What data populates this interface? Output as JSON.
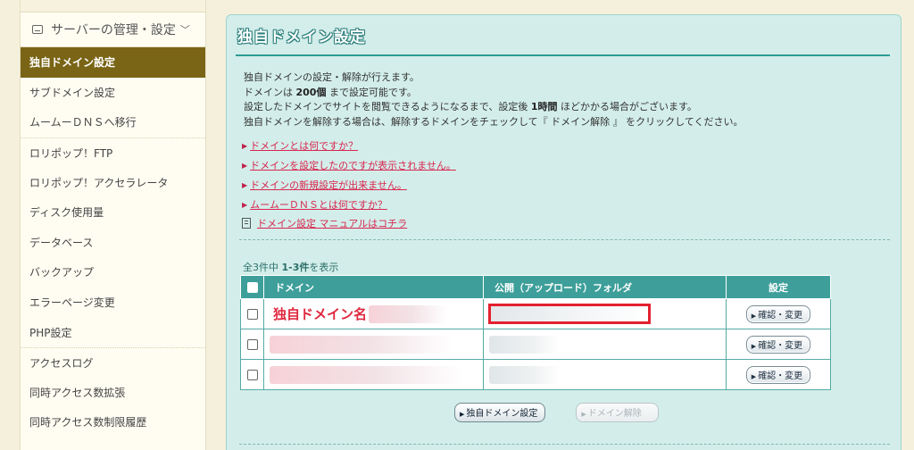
{
  "sidebar": {
    "section": {
      "label": "サーバーの管理・設定",
      "chevron": "﹀",
      "icon": "server-icon"
    },
    "items": [
      {
        "label": "独自ドメイン設定",
        "active": true
      },
      {
        "label": "サブドメイン設定"
      },
      {
        "label": "ムームーＤＮＳへ移行"
      },
      {
        "label": "ロリポップ！FTP"
      },
      {
        "label": "ロリポップ！アクセラレータ"
      },
      {
        "label": "ディスク使用量"
      },
      {
        "label": "データベース"
      },
      {
        "label": "バックアップ"
      },
      {
        "label": "エラーページ変更"
      },
      {
        "label": "PHP設定"
      },
      {
        "label": "アクセスログ"
      },
      {
        "label": "同時アクセス数拡張"
      },
      {
        "label": "同時アクセス数制限履歴"
      }
    ]
  },
  "main": {
    "title": "独自ドメイン設定",
    "desc": {
      "line1": "独自ドメインの設定・解除が行えます。",
      "line2_a": "ドメインは ",
      "line2_b": "200個",
      "line2_c": " まで設定可能です。",
      "line3_a": "設定したドメインでサイトを閲覧できるようになるまで、設定後 ",
      "line3_b": "1時間",
      "line3_c": " ほどかかる場合がございます。",
      "line4": "独自ドメインを解除する場合は、解除するドメインをチェックして『 ドメイン解除 』 をクリックしてください。"
    },
    "links": [
      "ドメインとは何ですか？",
      "ドメインを設定したのですが表示されません。",
      "ドメインの新規設定が出来ません。",
      "ムームーＤＮＳとは何ですか？"
    ],
    "manual_link": "ドメイン設定 マニュアルはコチラ",
    "count": {
      "prefix": "全3件中 ",
      "range": "1-3件",
      "suffix": "を表示"
    },
    "table": {
      "headers": [
        "ドメイン",
        "公開（アップロード）フォルダ",
        "設定"
      ],
      "rows": [
        {
          "domain": "独自ドメイン名",
          "action": "確認・変更"
        },
        {
          "domain": "",
          "action": "確認・変更"
        },
        {
          "domain": "",
          "action": "確認・変更"
        }
      ]
    },
    "buttons": {
      "add": "独自ドメイン設定",
      "remove": "ドメイン解除"
    }
  }
}
